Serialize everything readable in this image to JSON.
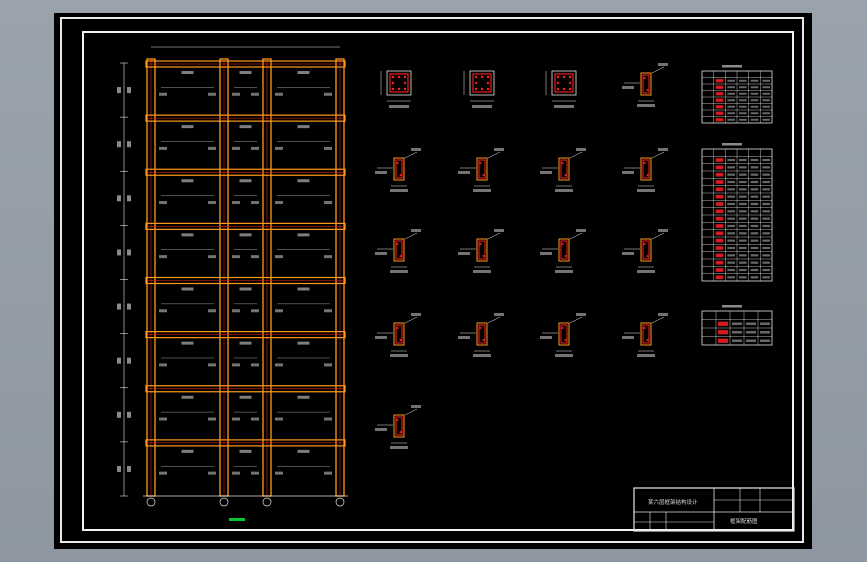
{
  "drawing": {
    "colors": {
      "background": "#000000",
      "line": "#e6e6e6",
      "beam": "#ff9a1a",
      "column": "#ff9a1a",
      "rebar": "#ff2020",
      "highlight": "#00c832"
    },
    "frame": {
      "stories": 8,
      "bays": 3,
      "column_labels": [
        "①",
        "②",
        "③",
        "④"
      ]
    },
    "sections": {
      "rows": [
        4,
        4,
        4,
        4,
        1
      ]
    },
    "tables": [
      {
        "rows": 8,
        "cols": 6
      },
      {
        "rows": 18,
        "cols": 6
      },
      {
        "rows": 4,
        "cols": 5
      }
    ]
  },
  "title_block": {
    "project_label": "某六层框架结构设计",
    "drawing_label": "框架配筋图"
  }
}
